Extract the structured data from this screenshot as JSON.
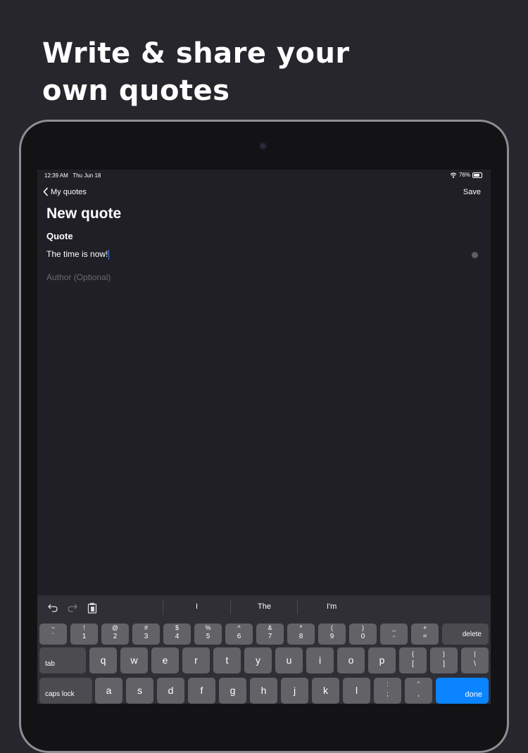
{
  "headline": {
    "line1": "Write & share your",
    "line2": "own quotes"
  },
  "status_bar": {
    "time": "12:39 AM",
    "date": "Thu Jun 18",
    "battery_text": "76%",
    "battery_level": 0.76
  },
  "nav": {
    "back_label": "My quotes",
    "save_label": "Save"
  },
  "form": {
    "title": "New quote",
    "section_label": "Quote",
    "quote_value": "The time is now!",
    "author_placeholder": "Author (Optional)"
  },
  "keyboard": {
    "suggestions": [
      "I",
      "The",
      "I'm"
    ],
    "number_row": [
      {
        "top": "~",
        "bottom": "`"
      },
      {
        "top": "!",
        "bottom": "1"
      },
      {
        "top": "@",
        "bottom": "2"
      },
      {
        "top": "#",
        "bottom": "3"
      },
      {
        "top": "$",
        "bottom": "4"
      },
      {
        "top": "%",
        "bottom": "5"
      },
      {
        "top": "^",
        "bottom": "6"
      },
      {
        "top": "&",
        "bottom": "7"
      },
      {
        "top": "*",
        "bottom": "8"
      },
      {
        "top": "(",
        "bottom": "9"
      },
      {
        "top": ")",
        "bottom": "0"
      },
      {
        "top": "_",
        "bottom": "-"
      },
      {
        "top": "+",
        "bottom": "="
      }
    ],
    "delete_label": "delete",
    "tab_label": "tab",
    "row2": [
      "q",
      "w",
      "e",
      "r",
      "t",
      "y",
      "u",
      "i",
      "o",
      "p"
    ],
    "row2_symbols": [
      {
        "top": "{",
        "bottom": "["
      },
      {
        "top": "}",
        "bottom": "]"
      },
      {
        "top": "|",
        "bottom": "\\"
      }
    ],
    "caps_label": "caps lock",
    "row3": [
      "a",
      "s",
      "d",
      "f",
      "g",
      "h",
      "j",
      "k",
      "l"
    ],
    "row3_symbols": [
      {
        "top": ":",
        "bottom": ";"
      },
      {
        "top": "\"",
        "bottom": ","
      }
    ],
    "done_label": "done"
  },
  "colors": {
    "background": "#27262d",
    "screen": "#1f1f25",
    "accent": "#0a84ff"
  },
  "icons": [
    "chevron-left-icon",
    "wifi-icon",
    "battery-icon",
    "clear-icon",
    "undo-icon",
    "redo-icon",
    "paste-icon"
  ]
}
